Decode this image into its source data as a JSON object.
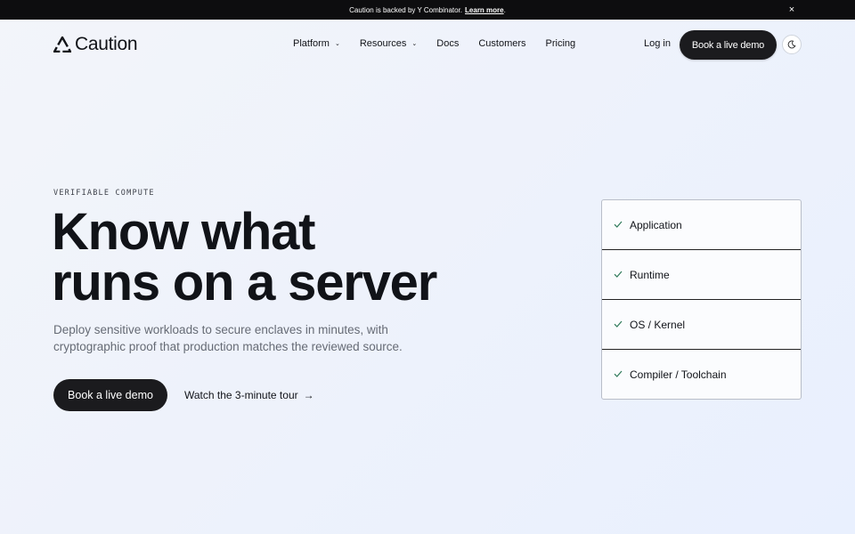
{
  "banner": {
    "text": "Caution is backed by Y Combinator.",
    "link": "Learn more",
    "suffix": ".",
    "close": "×"
  },
  "nav": {
    "logo_text": "Caution",
    "links": [
      {
        "label": "Platform",
        "has_dropdown": true
      },
      {
        "label": "Resources",
        "has_dropdown": true
      },
      {
        "label": "Docs"
      },
      {
        "label": "Customers"
      },
      {
        "label": "Pricing"
      }
    ],
    "login": "Log in",
    "demo": "Book a live demo",
    "theme_icon": "moon-icon"
  },
  "hero": {
    "eyebrow": "VERIFIABLE COMPUTE",
    "headline_line1": "Know what",
    "headline_line2": "runs on a server",
    "sub": "Deploy sensitive workloads to secure enclaves in minutes, with cryptographic proof that production matches the reviewed source.",
    "cta": "Book a live demo",
    "tour": "Watch the 3-minute tour",
    "tour_icon": "arrow-right-icon"
  },
  "checklist": {
    "items": [
      "Application",
      "Runtime",
      "OS / Kernel",
      "Compiler / Toolchain"
    ],
    "icon": "check-icon",
    "check_color": "#2f7a5a"
  },
  "colors": {
    "dark": "#1b1b1e",
    "muted_text": "#666b75",
    "background": "#eef2fb"
  }
}
